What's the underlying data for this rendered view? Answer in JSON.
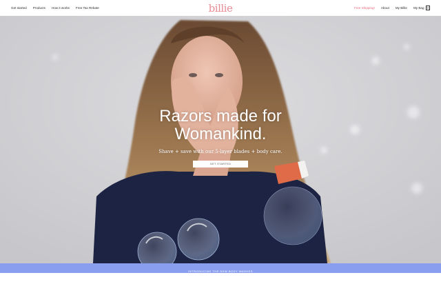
{
  "nav": {
    "left": [
      {
        "label": "Get started"
      },
      {
        "label": "Products"
      },
      {
        "label": "How it works"
      },
      {
        "label": "Free Tax Rebate"
      }
    ],
    "logo": "billie",
    "right": {
      "free_shipping": "Free Shipping!",
      "about": "About",
      "my_billie": "My Billie",
      "my_bag": "My Bag",
      "bag_count": "0"
    }
  },
  "hero": {
    "headline_line1": "Razors made for",
    "headline_line2": "Womankind.",
    "subhead": "Shave + save with our 5-layer blades + body care.",
    "cta": "GET STARTED"
  },
  "banner": {
    "text": "INTRODUCING THE NEW BODY WASHES"
  },
  "colors": {
    "brand_pink": "#e88b95",
    "banner_blue": "#8a9ef0",
    "hero_bg": "#d3d3d6",
    "sweater_navy": "#1d2342"
  }
}
